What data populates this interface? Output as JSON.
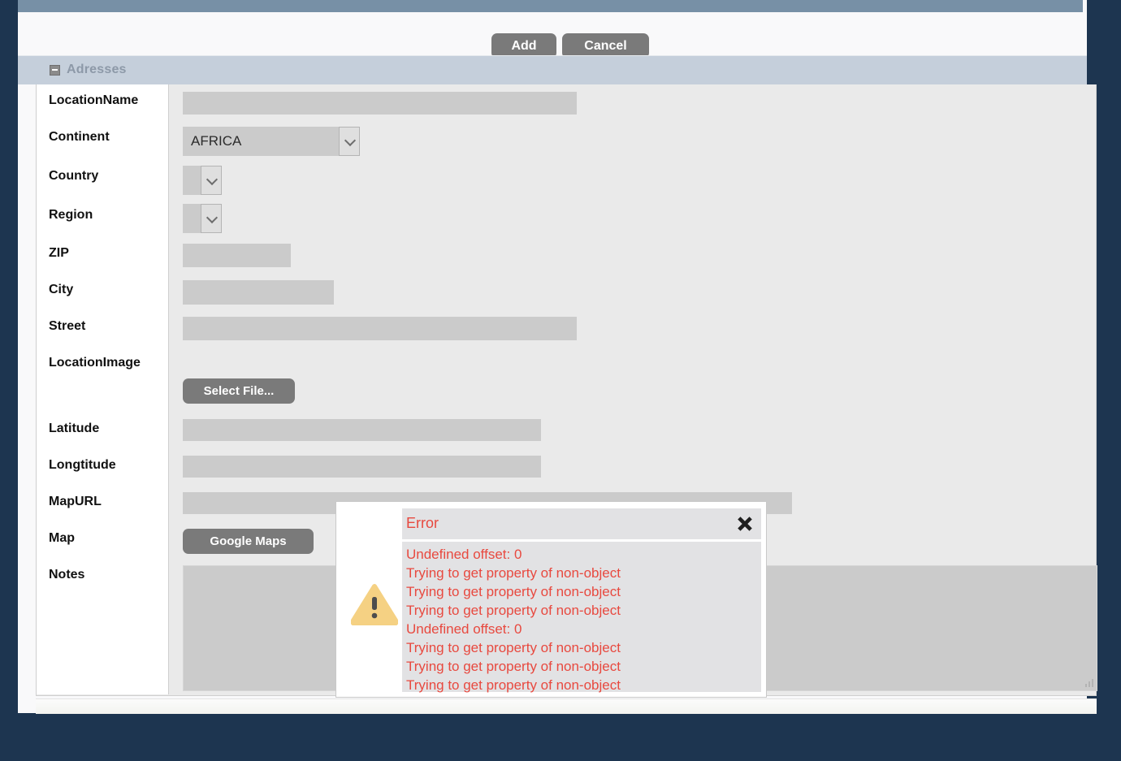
{
  "window": {
    "background_color": "#1d3550",
    "topbar_color": "#7790a6"
  },
  "toolbar": {
    "add_label": "Add",
    "cancel_label": "Cancel"
  },
  "section": {
    "title": "Adresses",
    "collapse_icon": "minus-square-icon",
    "header_color": "#c5cfdb"
  },
  "form": {
    "fields": [
      {
        "label": "LocationName",
        "type": "text",
        "value": ""
      },
      {
        "label": "Continent",
        "type": "select",
        "value": "AFRICA"
      },
      {
        "label": "Country",
        "type": "select",
        "value": ""
      },
      {
        "label": "Region",
        "type": "select",
        "value": ""
      },
      {
        "label": "ZIP",
        "type": "text",
        "value": ""
      },
      {
        "label": "City",
        "type": "text",
        "value": ""
      },
      {
        "label": "Street",
        "type": "text",
        "value": ""
      },
      {
        "label": "LocationImage",
        "type": "file",
        "value": ""
      },
      {
        "label": "Latitude",
        "type": "text",
        "value": ""
      },
      {
        "label": "Longtitude",
        "type": "text",
        "value": ""
      },
      {
        "label": "MapURL",
        "type": "text",
        "value": ""
      },
      {
        "label": "Map",
        "type": "button",
        "value": ""
      },
      {
        "label": "Notes",
        "type": "textarea",
        "value": ""
      }
    ],
    "select_file_label": "Select File...",
    "google_maps_label": "Google Maps"
  },
  "error_dialog": {
    "title": "Error",
    "close_icon": "close-x-icon",
    "warning_icon": "warning-triangle-icon",
    "title_color": "#e8493f",
    "messages": [
      "Undefined offset: 0",
      "Trying to get property of non-object",
      "Trying to get property of non-object",
      "Trying to get property of non-object",
      "Undefined offset: 0",
      "Trying to get property of non-object",
      "Trying to get property of non-object",
      "Trying to get property of non-object"
    ]
  }
}
